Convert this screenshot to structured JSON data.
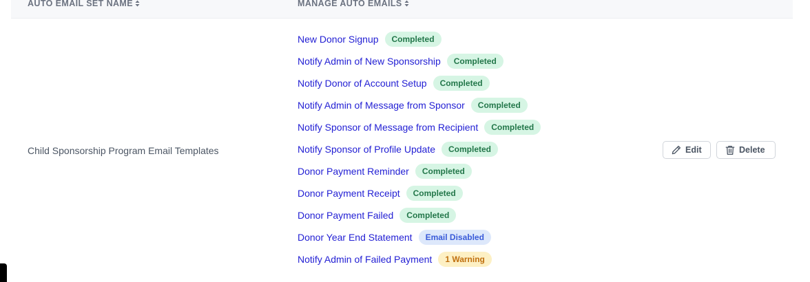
{
  "table": {
    "headers": {
      "set_name": "AUTO EMAIL SET NAME",
      "manage": "MANAGE AUTO EMAILS"
    },
    "row": {
      "set_name": "Child Sponsorship Program Email Templates",
      "emails": [
        {
          "label": "New Donor Signup",
          "status": "Completed",
          "status_type": "completed"
        },
        {
          "label": "Notify Admin of New Sponsorship",
          "status": "Completed",
          "status_type": "completed"
        },
        {
          "label": "Notify Donor of Account Setup",
          "status": "Completed",
          "status_type": "completed"
        },
        {
          "label": "Notify Admin of Message from Sponsor",
          "status": "Completed",
          "status_type": "completed"
        },
        {
          "label": "Notify Sponsor of Message from Recipient",
          "status": "Completed",
          "status_type": "completed"
        },
        {
          "label": "Notify Sponsor of Profile Update",
          "status": "Completed",
          "status_type": "completed"
        },
        {
          "label": "Donor Payment Reminder",
          "status": "Completed",
          "status_type": "completed"
        },
        {
          "label": "Donor Payment Receipt",
          "status": "Completed",
          "status_type": "completed"
        },
        {
          "label": "Donor Payment Failed",
          "status": "Completed",
          "status_type": "completed"
        },
        {
          "label": "Donor Year End Statement",
          "status": "Email Disabled",
          "status_type": "disabled"
        },
        {
          "label": "Notify Admin of Failed Payment",
          "status": "1 Warning",
          "status_type": "warning"
        }
      ],
      "actions": {
        "edit_label": "Edit",
        "edit_icon": "pencil-icon",
        "delete_label": "Delete",
        "delete_icon": "trash-icon"
      }
    }
  },
  "colors": {
    "link": "#2320d4",
    "completed_bg": "#d6f5e4",
    "completed_text": "#23774a",
    "disabled_bg": "#dde8fb",
    "disabled_text": "#3a5bd9",
    "warning_bg": "#fdf0c4",
    "warning_text": "#c0700f"
  }
}
